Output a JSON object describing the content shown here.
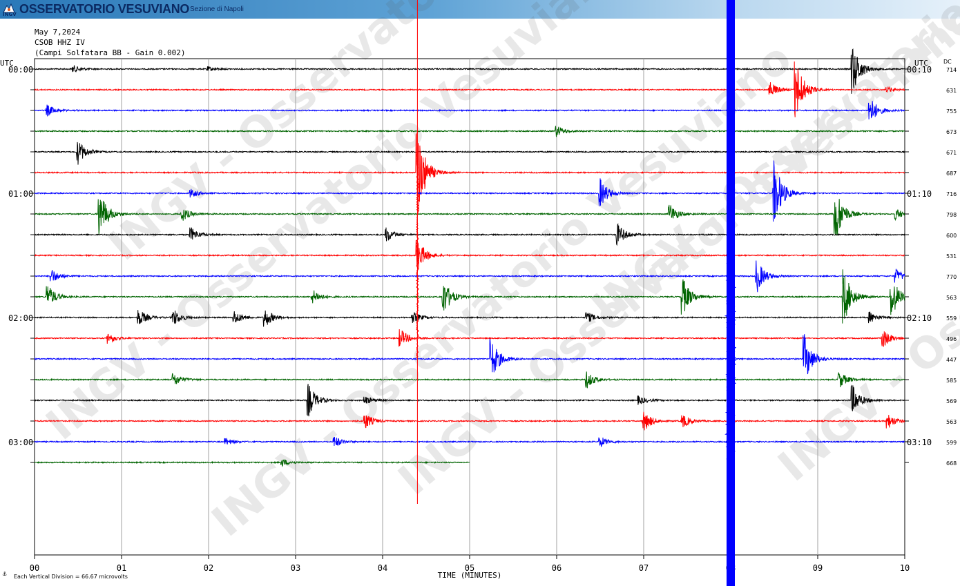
{
  "header": {
    "brand": "OSSERVATORIO VESUVIANO",
    "section": "Sezione di Napoli",
    "logo_text": "INGV"
  },
  "chart_info": {
    "date": "May 7,2024",
    "station": "CSOB HHZ IV",
    "description": "(Campi Solfatara BB - Gain 0.002)",
    "watermark": "INGV - Osservatorio Vesuviano"
  },
  "colors": {
    "black": "#000000",
    "red": "#ff0000",
    "blue": "#0000ff",
    "green": "#006400",
    "grid": "#a0a0a0"
  },
  "chart_data": {
    "type": "line",
    "title": "",
    "xlabel": "TIME (MINUTES)",
    "x_ticks": [
      "00",
      "01",
      "02",
      "03",
      "04",
      "05",
      "06",
      "07",
      "08",
      "09",
      "10"
    ],
    "xlim": [
      0,
      10
    ],
    "left_axis_label": "UTC",
    "right_axis_label": "UTC",
    "dc_label": "DC",
    "left_time_labels": [
      {
        "row": 0,
        "text": "00:00"
      },
      {
        "row": 6,
        "text": "01:00"
      },
      {
        "row": 12,
        "text": "02:00"
      },
      {
        "row": 18,
        "text": "03:00"
      }
    ],
    "right_time_labels": [
      {
        "row": 0,
        "text": "00:10"
      },
      {
        "row": 6,
        "text": "01:10"
      },
      {
        "row": 12,
        "text": "02:10"
      },
      {
        "row": 18,
        "text": "03:10"
      }
    ],
    "dc_values": [
      "714",
      "631",
      "755",
      "673",
      "671",
      "687",
      "716",
      "798",
      "600",
      "531",
      "770",
      "563",
      "559",
      "496",
      "447",
      "585",
      "569",
      "563",
      "599",
      "668"
    ],
    "trace_colors": [
      "black",
      "red",
      "blue",
      "green"
    ],
    "trace_end_minute_last_row": 5.0,
    "scale_note": "Each Vertical Division =   66.67 microvolts",
    "series": [
      {
        "row": 0,
        "events": [
          {
            "t": 0.45,
            "a": 5
          },
          {
            "t": 2.0,
            "a": 3
          },
          {
            "t": 9.4,
            "a": 38
          }
        ]
      },
      {
        "row": 1,
        "events": [
          {
            "t": 8.75,
            "a": 45
          },
          {
            "t": 8.45,
            "a": 12
          },
          {
            "t": 9.8,
            "a": 4
          }
        ]
      },
      {
        "row": 2,
        "events": [
          {
            "t": 0.15,
            "a": 8
          },
          {
            "t": 9.6,
            "a": 20
          }
        ]
      },
      {
        "row": 3,
        "events": [
          {
            "t": 6.0,
            "a": 8
          }
        ]
      },
      {
        "row": 4,
        "events": [
          {
            "t": 0.5,
            "a": 18
          }
        ]
      },
      {
        "row": 5,
        "events": [
          {
            "t": 4.4,
            "a": 70
          }
        ]
      },
      {
        "row": 6,
        "events": [
          {
            "t": 1.8,
            "a": 6
          },
          {
            "t": 6.5,
            "a": 22
          },
          {
            "t": 8.5,
            "a": 50
          }
        ]
      },
      {
        "row": 7,
        "events": [
          {
            "t": 0.75,
            "a": 35
          },
          {
            "t": 1.7,
            "a": 10
          },
          {
            "t": 7.3,
            "a": 15
          },
          {
            "t": 9.2,
            "a": 45
          },
          {
            "t": 9.9,
            "a": 8
          }
        ]
      },
      {
        "row": 8,
        "events": [
          {
            "t": 1.8,
            "a": 10
          },
          {
            "t": 4.05,
            "a": 10
          },
          {
            "t": 6.7,
            "a": 16
          }
        ]
      },
      {
        "row": 9,
        "events": [
          {
            "t": 4.4,
            "a": 25
          }
        ]
      },
      {
        "row": 10,
        "events": [
          {
            "t": 0.2,
            "a": 10
          },
          {
            "t": 8.3,
            "a": 25
          },
          {
            "t": 9.9,
            "a": 10
          }
        ]
      },
      {
        "row": 11,
        "events": [
          {
            "t": 0.15,
            "a": 18
          },
          {
            "t": 3.2,
            "a": 10
          },
          {
            "t": 4.7,
            "a": 26
          },
          {
            "t": 7.45,
            "a": 28
          },
          {
            "t": 9.3,
            "a": 40
          },
          {
            "t": 9.85,
            "a": 30
          }
        ]
      },
      {
        "row": 12,
        "events": [
          {
            "t": 1.2,
            "a": 12
          },
          {
            "t": 1.6,
            "a": 12
          },
          {
            "t": 2.3,
            "a": 10
          },
          {
            "t": 2.65,
            "a": 14
          },
          {
            "t": 4.35,
            "a": 8
          },
          {
            "t": 6.35,
            "a": 8
          },
          {
            "t": 9.6,
            "a": 8
          }
        ]
      },
      {
        "row": 13,
        "events": [
          {
            "t": 0.85,
            "a": 8
          },
          {
            "t": 4.2,
            "a": 14
          },
          {
            "t": 9.75,
            "a": 14
          }
        ]
      },
      {
        "row": 14,
        "events": [
          {
            "t": 5.25,
            "a": 30
          },
          {
            "t": 8.85,
            "a": 35
          }
        ]
      },
      {
        "row": 15,
        "events": [
          {
            "t": 1.6,
            "a": 10
          },
          {
            "t": 6.35,
            "a": 12
          },
          {
            "t": 9.25,
            "a": 12
          }
        ]
      },
      {
        "row": 16,
        "events": [
          {
            "t": 3.15,
            "a": 24
          },
          {
            "t": 3.8,
            "a": 6
          },
          {
            "t": 6.95,
            "a": 6
          },
          {
            "t": 9.4,
            "a": 22
          }
        ]
      },
      {
        "row": 17,
        "events": [
          {
            "t": 3.8,
            "a": 12
          },
          {
            "t": 7.0,
            "a": 16
          },
          {
            "t": 7.45,
            "a": 10
          },
          {
            "t": 9.8,
            "a": 12
          }
        ]
      },
      {
        "row": 18,
        "events": [
          {
            "t": 2.2,
            "a": 5
          },
          {
            "t": 3.45,
            "a": 8
          },
          {
            "t": 6.5,
            "a": 8
          }
        ]
      },
      {
        "row": 19,
        "events": [
          {
            "t": 2.85,
            "a": 5
          }
        ]
      }
    ],
    "big_events": [
      {
        "rows": [
          5,
          13
        ],
        "t": 4.4,
        "color": "red",
        "a": 80
      },
      {
        "rows": [
          10,
          18
        ],
        "t": 8.0,
        "color": "blue",
        "a": 110
      }
    ]
  }
}
